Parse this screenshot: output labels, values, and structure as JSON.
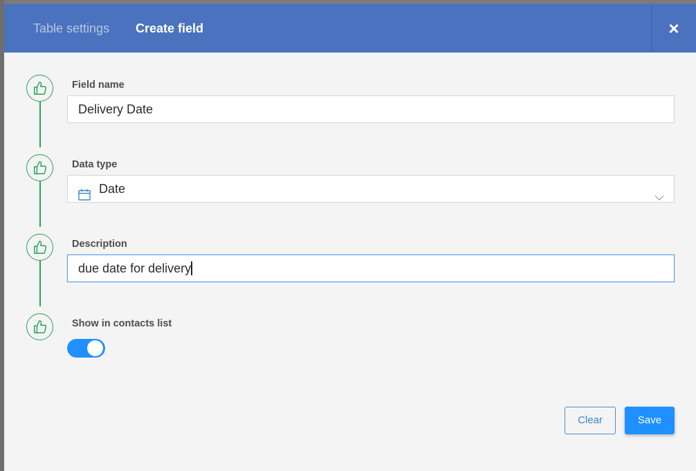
{
  "header": {
    "tabs": [
      {
        "label": "Table settings",
        "active": false
      },
      {
        "label": "Create field",
        "active": true
      }
    ],
    "close_label": "×"
  },
  "form": {
    "field_name": {
      "label": "Field name",
      "value": "Delivery Date"
    },
    "data_type": {
      "label": "Data type",
      "value": "Date",
      "icon": "calendar-icon"
    },
    "description": {
      "label": "Description",
      "value": "due date for delivery"
    },
    "show_in_contacts": {
      "label": "Show in contacts list",
      "enabled": true
    }
  },
  "buttons": {
    "clear_label": "Clear",
    "save_label": "Save"
  },
  "colors": {
    "header_bg": "#4a72bf",
    "accent": "#1e90ff",
    "step_green": "#27a35a",
    "modal_bg": "#f4f4f4"
  }
}
